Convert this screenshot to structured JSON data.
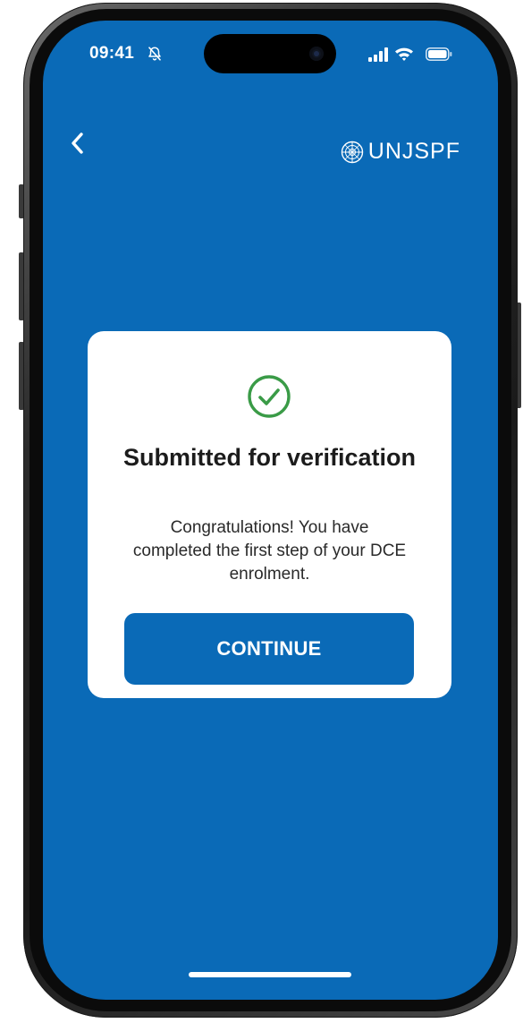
{
  "status_bar": {
    "time": "09:41",
    "icons": [
      "bell-slash-icon",
      "signal-icon",
      "wifi-icon",
      "battery-icon"
    ]
  },
  "header": {
    "back_icon": "chevron-left-icon",
    "brand_icon": "un-emblem-icon",
    "brand_name": "UNJSPF"
  },
  "dialog": {
    "icon": "check-circle-icon",
    "title": "Submitted for verification",
    "message": "Congratulations! You have completed the first step of your DCE enrolment.",
    "button_label": "CONTINUE"
  },
  "colors": {
    "background": "#0a6ab7",
    "card": "#ffffff",
    "success": "#3a9b47",
    "button": "#0a6ab7",
    "text_dark": "#1c1c1c"
  }
}
